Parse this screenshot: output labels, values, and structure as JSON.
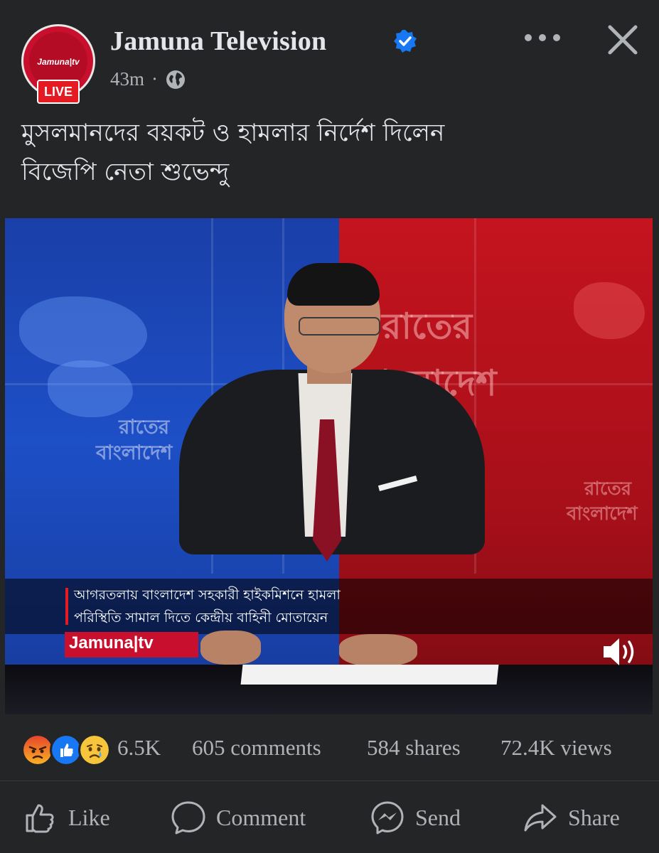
{
  "header": {
    "page_name": "Jamuna Television",
    "avatar_logo": "Jamuna|tv",
    "live_label": "LIVE",
    "time_ago": "43m",
    "separator": "·"
  },
  "icons": {
    "verified": "verified-badge-icon",
    "privacy": "globe-icon",
    "more": "more-options-icon",
    "close": "close-icon",
    "volume": "volume-icon"
  },
  "caption": {
    "line1": "মুসলমানদের বয়কট ও হামলার নির্দেশ দিলেন",
    "line2": "বিজেপি নেতা শুভেন্দু"
  },
  "video": {
    "bg_text_left_1": "রাতের",
    "bg_text_left_2": "বাংলাদেশ",
    "bg_text_right_1": "রাতের",
    "bg_text_right_2": "বাংলাদেশ",
    "ticker_line1": "আগরতলায় বাংলাদেশ সহকারী হাইকমিশনে হামলা",
    "ticker_line2": "পরিস্থিতি সামাল দিতে কেন্দ্রীয় বাহিনী মোতায়েন",
    "channel_logo": "Jamuna|tv"
  },
  "stats": {
    "reaction_count": "6.5K",
    "comments": "605 comments",
    "shares": "584 shares",
    "views": "72.4K views"
  },
  "actions": {
    "like": "Like",
    "comment": "Comment",
    "send": "Send",
    "share": "Share"
  },
  "colors": {
    "background": "#242526",
    "text_primary": "#e4e6eb",
    "text_secondary": "#b0b3b8",
    "verified_blue": "#1877f2",
    "live_red": "#e41b23"
  }
}
